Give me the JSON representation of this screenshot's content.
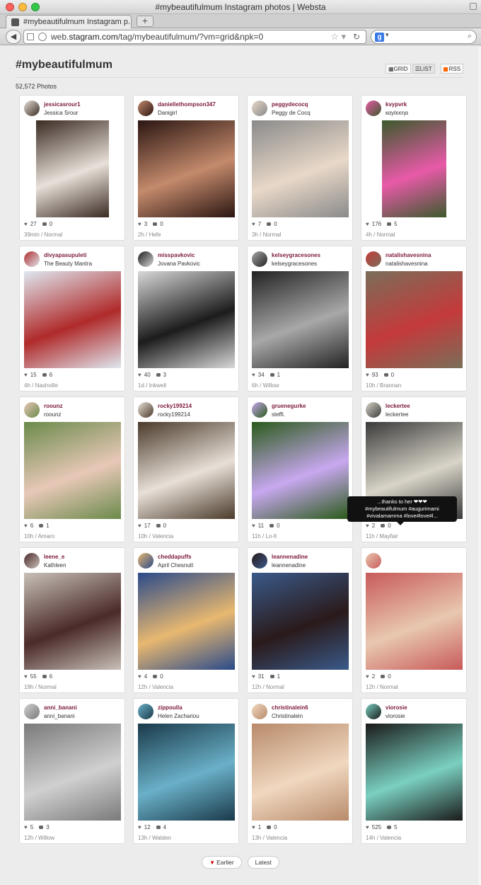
{
  "window": {
    "title": "#mybeautifulmum Instagram photos | Websta"
  },
  "tab": {
    "label": "#mybeautifulmum Instagram p...",
    "new_tab": "+"
  },
  "url": {
    "scheme": "web.",
    "host": "stagram.com",
    "path": "/tag/mybeautifulmum/?vm=grid&npk=0"
  },
  "search": {
    "engine": "g"
  },
  "page": {
    "title": "#mybeautifulmum",
    "photo_count": "52,572 Photos",
    "view_grid": "GRID",
    "view_list": "LIST",
    "view_rss": "RSS"
  },
  "colors": {
    "username": "#7c1a3a",
    "accent": "#c00000"
  },
  "posts": [
    {
      "user": "jessicasrour1",
      "name": "Jessica Srour",
      "likes": "27",
      "comments": "0",
      "time": "39min / Normal",
      "photo_colors": [
        "#3a2a22",
        "#e8e1d9"
      ]
    },
    {
      "user": "daniellethompson347",
      "name": "Danigirl",
      "likes": "3",
      "comments": "0",
      "time": "2h / Hefe",
      "photo_colors": [
        "#2b1612",
        "#c48a6c"
      ]
    },
    {
      "user": "peggydecocq",
      "name": "Peggy de Cocq",
      "likes": "7",
      "comments": "0",
      "time": "3h / Normal",
      "photo_colors": [
        "#8a8a8a",
        "#e8d8c8"
      ]
    },
    {
      "user": "kvypvrk",
      "name": "кαуℓєєηα",
      "likes": "176",
      "comments": "5",
      "time": "4h / Normal",
      "photo_colors": [
        "#3c5a2c",
        "#e85aa8"
      ]
    },
    {
      "user": "divyapasupuleti",
      "name": "The Beauty Mantra",
      "likes": "15",
      "comments": "6",
      "time": "4h / Nashville",
      "photo_colors": [
        "#dfe8f0",
        "#b02a2a"
      ]
    },
    {
      "user": "misspavkovic",
      "name": "Jovana Pavkovic",
      "likes": "40",
      "comments": "3",
      "time": "1d / Inkwell",
      "photo_colors": [
        "#d8d8d8",
        "#1c1c1c"
      ]
    },
    {
      "user": "kelseygracesones",
      "name": "kelseygracesones",
      "likes": "34",
      "comments": "1",
      "time": "6h / Willow",
      "photo_colors": [
        "#222222",
        "#a8a8a8"
      ]
    },
    {
      "user": "natalishavesnina",
      "name": "natalishavesnina",
      "likes": "93",
      "comments": "0",
      "time": "10h / Brannan",
      "photo_colors": [
        "#7a6e5a",
        "#c43a3a"
      ]
    },
    {
      "user": "roounz",
      "name": "roounz",
      "likes": "6",
      "comments": "1",
      "time": "10h / Amaro",
      "photo_colors": [
        "#6a8a4a",
        "#e8c8b8"
      ]
    },
    {
      "user": "rocky199214",
      "name": "rocky199214",
      "likes": "17",
      "comments": "0",
      "time": "10h / Valencia",
      "photo_colors": [
        "#4a3a2a",
        "#e8e0d8"
      ]
    },
    {
      "user": "gruenegurke",
      "name": "steffi.",
      "likes": "11",
      "comments": "0",
      "time": "11h / Lo-fi",
      "photo_colors": [
        "#2a5a1a",
        "#c8a8f0"
      ]
    },
    {
      "user": "leckertee",
      "name": "leckertee",
      "likes": "2",
      "comments": "0",
      "time": "11h / Mayfair",
      "photo_colors": [
        "#3a3a3a",
        "#d8d4c8"
      ]
    },
    {
      "user": "leene_e",
      "name": "Kathleen",
      "likes": "55",
      "comments": "6",
      "time": "19h / Normal",
      "photo_colors": [
        "#c8c0b8",
        "#4a2a2a"
      ]
    },
    {
      "user": "cheddapuffs",
      "name": "April Chesnutt",
      "likes": "4",
      "comments": "0",
      "time": "12h / Valencia",
      "photo_colors": [
        "#2a4a8a",
        "#e8b870"
      ]
    },
    {
      "user": "leannenadine",
      "name": "leannenadine",
      "likes": "31",
      "comments": "1",
      "time": "12h / Normal",
      "photo_colors": [
        "#3a5a8a",
        "#2a1a1a"
      ]
    },
    {
      "user": "",
      "name": "",
      "likes": "2",
      "comments": "0",
      "time": "12h / Normal",
      "photo_colors": [
        "#c85a5a",
        "#e8c8b0"
      ]
    },
    {
      "user": "anni_banani",
      "name": "anni_banani",
      "likes": "5",
      "comments": "3",
      "time": "12h / Willow",
      "photo_colors": [
        "#7a7a7a",
        "#d0d0d0"
      ]
    },
    {
      "user": "zippoulla",
      "name": "Helen Zachariou",
      "likes": "12",
      "comments": "4",
      "time": "13h / Walden",
      "photo_colors": [
        "#1a3a4a",
        "#6ab0c8"
      ]
    },
    {
      "user": "christinalein6",
      "name": "Christinalein",
      "likes": "1",
      "comments": "0",
      "time": "13h / Valencia",
      "photo_colors": [
        "#b88a6a",
        "#f0d8c0"
      ]
    },
    {
      "user": "viorosie",
      "name": "viorosie",
      "likes": "525",
      "comments": "5",
      "time": "14h / Valencia",
      "photo_colors": [
        "#1a1a1a",
        "#7ad0c0"
      ]
    }
  ],
  "tooltip": {
    "line1": "...thanks to her ❤❤❤",
    "line2": "#mybeautifulmum #augurimami",
    "line3": "#vivalamamma #love#love#l..."
  },
  "pager": {
    "earlier": "Earlier",
    "latest": "Latest"
  }
}
